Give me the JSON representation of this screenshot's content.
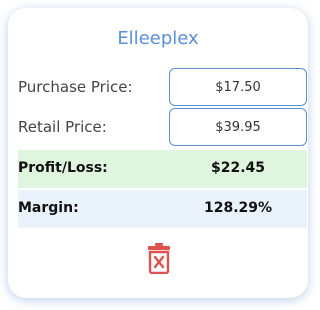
{
  "app": {
    "title": "Elleeplex"
  },
  "inputs": {
    "purchase": {
      "label": "Purchase Price:",
      "value": "$17.50"
    },
    "retail": {
      "label": "Retail Price:",
      "value": "$39.95"
    }
  },
  "results": {
    "profit": {
      "label": "Profit/Loss:",
      "value": "$22.45"
    },
    "margin": {
      "label": "Margin:",
      "value": "128.29%"
    }
  },
  "actions": {
    "clear_icon": "trash-icon"
  },
  "colors": {
    "accent": "#5b8fd6",
    "profit_bg": "#dff5dd",
    "margin_bg": "#eaf2fc",
    "danger": "#e0524e"
  }
}
